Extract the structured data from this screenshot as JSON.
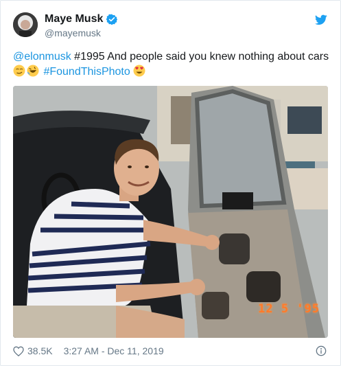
{
  "author": {
    "name": "Maye Musk",
    "handle": "@mayemusk",
    "verified": true,
    "avatar_icon": "avatar-portrait"
  },
  "tweet": {
    "mention": "@elonmusk",
    "text": " #1995 And people said you knew nothing about cars",
    "emojis_line2": [
      "smirking-face-emoji",
      "rolling-on-floor-laughing-emoji"
    ],
    "hashtag": "#FoundThisPhoto",
    "emoji_end": "heart-eyes-emoji"
  },
  "photo": {
    "date_stamp": "12  5 '95"
  },
  "footer": {
    "likes": "38.5K",
    "timestamp": "3:27 AM - Dec 11, 2019"
  },
  "colors": {
    "link": "#1b95e0",
    "brand": "#1da1f2",
    "text": "#14171a",
    "muted": "#657786"
  },
  "icons": {
    "logo": "twitter-bird-icon",
    "verified": "verified-badge-icon",
    "like": "heart-icon",
    "info": "info-icon"
  }
}
